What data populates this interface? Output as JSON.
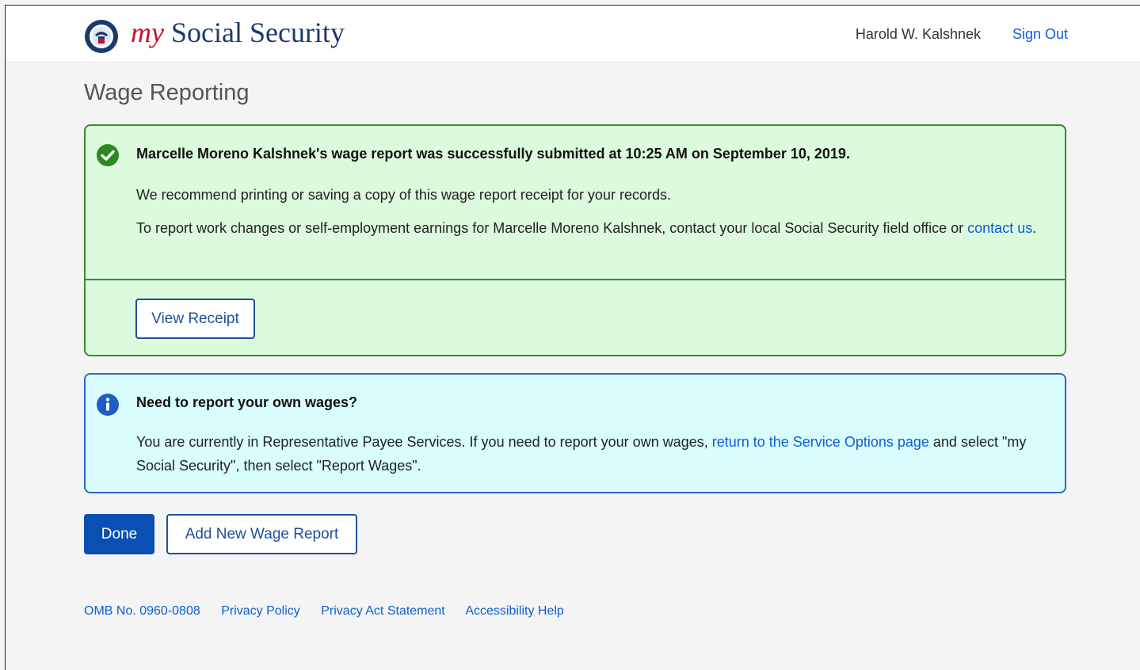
{
  "header": {
    "logo_prefix": "my",
    "logo_text": "Social Security",
    "user_name": "Harold W. Kalshnek",
    "sign_out": "Sign Out"
  },
  "page": {
    "title": "Wage Reporting"
  },
  "success_alert": {
    "icon": "check-circle-icon",
    "heading": "Marcelle Moreno Kalshnek's wage report was successfully submitted at 10:25 AM on September 10, 2019.",
    "para1": "We recommend printing or saving a copy of this wage report receipt for your records.",
    "para2_text": "To report work changes or self-employment earnings for Marcelle Moreno Kalshnek, contact your local Social Security field office or ",
    "para2_link": "contact us",
    "para2_end": ".",
    "view_receipt": "View Receipt",
    "color": "#dcfadc",
    "border_color": "#3a8a2e"
  },
  "info_alert": {
    "icon": "info-circle-icon",
    "heading": "Need to report your own wages?",
    "text_before": "You are currently in Representative Payee Services. If you need to report your own wages, ",
    "link": "return to the Service Options page",
    "text_after": " and select \"my Social Security\", then select \"Report Wages\".",
    "color": "#d9fcfd",
    "border_color": "#2c67c7"
  },
  "actions": {
    "done": "Done",
    "add_new": "Add New Wage Report"
  },
  "footer": {
    "links": [
      "OMB No. 0960-0808",
      "Privacy Policy",
      "Privacy Act Statement",
      "Accessibility Help"
    ]
  }
}
